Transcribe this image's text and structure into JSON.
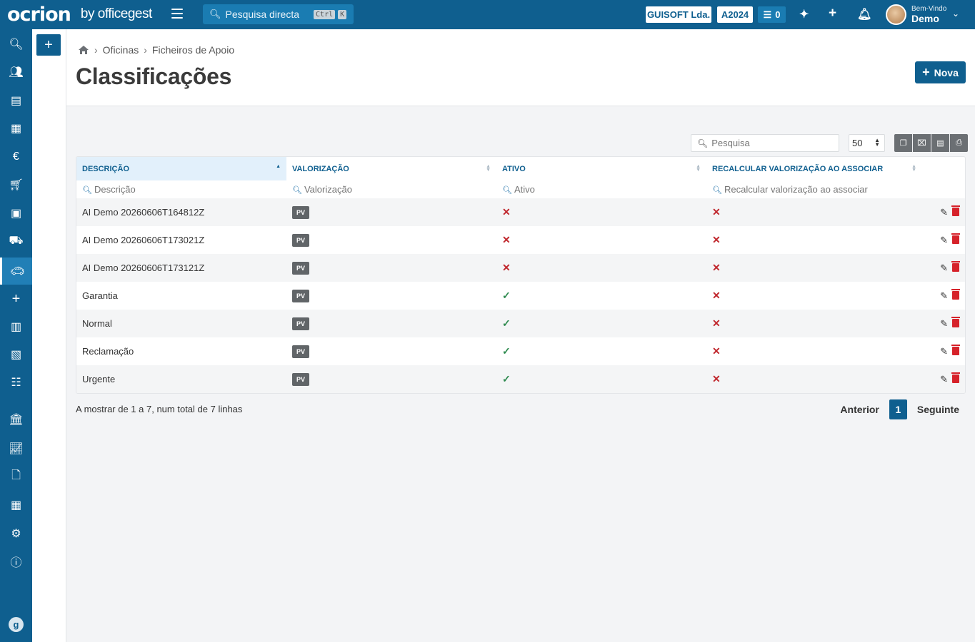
{
  "topbar": {
    "logo_mark": "ocrion",
    "logo_by": "by officegest",
    "search_placeholder": "Pesquisa directa",
    "kbd1": "Ctrl",
    "kbd2": "K",
    "company": "GUISOFT Lda.",
    "year": "A2024",
    "tasks_count": "0",
    "welcome_small": "Bem-Vindo",
    "welcome_user": "Demo"
  },
  "sidebar": {
    "items": [
      "search-icon",
      "users-icon",
      "book-icon",
      "warehouse-icon",
      "euro-icon",
      "cart-icon",
      "money-icon",
      "vehicles-icon",
      "car-icon",
      "plus-icon",
      "calculator-icon",
      "box-icon",
      "org-chart-icon",
      "bank-icon",
      "analytics-icon",
      "document-icon",
      "table-icon",
      "settings-icon",
      "help-icon"
    ],
    "bottom": "g"
  },
  "breadcrumb": {
    "level1": "Oficinas",
    "level2": "Ficheiros de Apoio"
  },
  "page_title": "Classificações",
  "new_button": "Nova",
  "toolbar": {
    "search_placeholder": "Pesquisa",
    "page_size": "50"
  },
  "table": {
    "columns": [
      "DESCRIÇÃO",
      "VALORIZAÇÃO",
      "ATIVO",
      "RECALCULAR VALORIZAÇÃO AO ASSOCIAR"
    ],
    "filters": [
      "Descrição",
      "Valorização",
      "Ativo",
      "Recalcular valorização ao associar"
    ],
    "rows": [
      {
        "descricao": "AI Demo 20260606T164812Z",
        "valorizacao": "PV",
        "ativo": false,
        "recalcular": false
      },
      {
        "descricao": "AI Demo 20260606T173021Z",
        "valorizacao": "PV",
        "ativo": false,
        "recalcular": false
      },
      {
        "descricao": "AI Demo 20260606T173121Z",
        "valorizacao": "PV",
        "ativo": false,
        "recalcular": false
      },
      {
        "descricao": "Garantia",
        "valorizacao": "PV",
        "ativo": true,
        "recalcular": false
      },
      {
        "descricao": "Normal",
        "valorizacao": "PV",
        "ativo": true,
        "recalcular": false
      },
      {
        "descricao": "Reclamação",
        "valorizacao": "PV",
        "ativo": true,
        "recalcular": false
      },
      {
        "descricao": "Urgente",
        "valorizacao": "PV",
        "ativo": true,
        "recalcular": false
      }
    ]
  },
  "footer": {
    "summary": "A mostrar de 1 a 7, num total de 7 linhas",
    "prev": "Anterior",
    "page": "1",
    "next": "Seguinte"
  },
  "colors": {
    "primary": "#0f5f8f",
    "danger": "#c0272d",
    "success": "#2d8a4e"
  }
}
